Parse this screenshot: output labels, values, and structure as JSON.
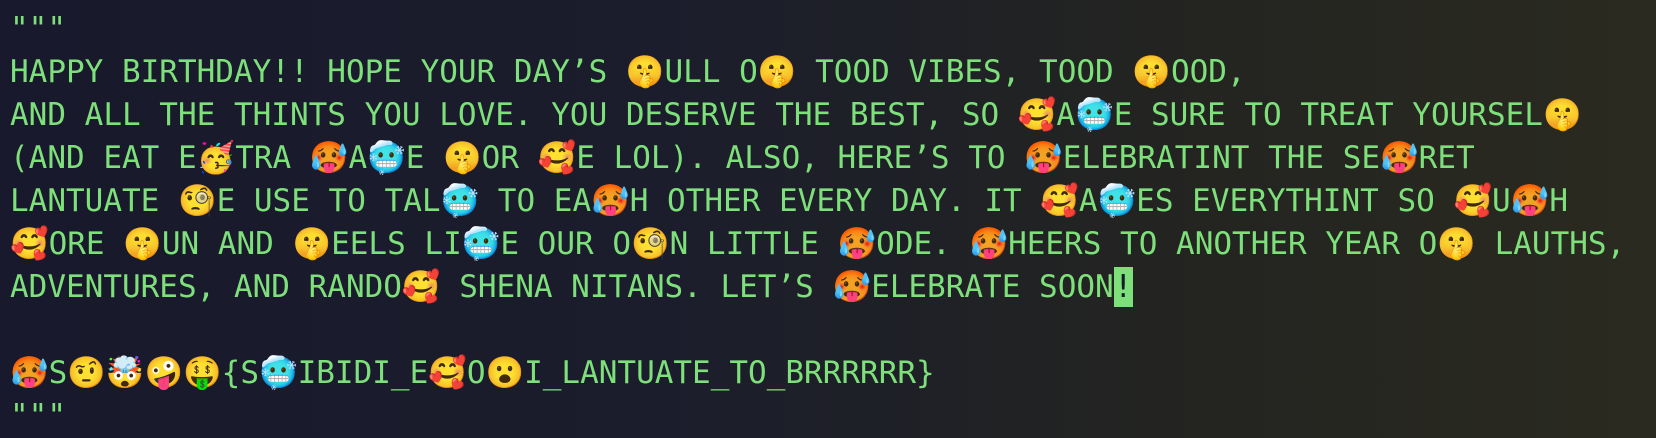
{
  "terminal": {
    "lines": [
      "\"\"\"",
      "HAPPY BIRTHDAY!! HOPE YOUR DAY’S 🤫ULL O🤫 TOOD VIBES, TOOD 🤫OOD,",
      "AND ALL THE THINTS YOU LOVE. YOU DESERVE THE BEST, SO 🥰A🥶E SURE TO TREAT YOURSEL🤫",
      "(AND EAT E🥳TRA 🥵A🥶E 🤫OR 🥰E LOL). ALSO, HERE’S TO 🥵ELEBRATINT THE SE🥵RET",
      "LANTUATE 🧐E USE TO TAL🥶 TO EA🥵H OTHER EVERY DAY. IT 🥰A🥶ES EVERYTHINT SO 🥰U🥵H",
      "🥰ORE 🤫UN AND 🤫EELS LI🥶E OUR O🧐N LITTLE 🥵ODE. 🥵HEERS TO ANOTHER YEAR O🤫 LAUTHS,",
      "ADVENTURES, AND RANDO🥰 SHENA NITANS. LET’S 🥵ELEBRATE SOON",
      "",
      "🥵S🤨🤯🤪🤑{S🥶IBIDI_E🥰O😮I_LANTUATE_TO_BRRRRRR}",
      "\"\"\""
    ],
    "cursor_char": "!"
  },
  "colors": {
    "text": "#7ee07a",
    "background_left": "#18192c",
    "background_right": "#2a2a20"
  }
}
